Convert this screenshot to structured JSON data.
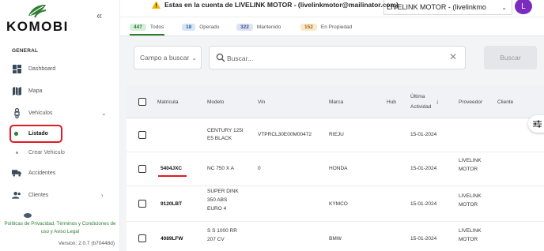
{
  "brand": {
    "logo_text": "KOMOBI",
    "accent": "#2e7d32"
  },
  "sidebar": {
    "section_label": "GENERAL",
    "items": [
      {
        "label": "Dashboard",
        "icon": "dashboard-icon"
      },
      {
        "label": "Mapa",
        "icon": "map-icon"
      },
      {
        "label": "Vehículos",
        "icon": "vehicle-icon",
        "expanded": true
      },
      {
        "label": "Accidentes",
        "icon": "accident-truck-icon"
      },
      {
        "label": "Clientes",
        "icon": "clients-icon"
      }
    ],
    "sub_items": [
      {
        "label": "Listado",
        "active": true
      },
      {
        "label": "Crear Vehiculo",
        "active": false
      }
    ],
    "footer_links": "Políticas de Privacidad, Términos y Condiciones de uso y Aviso Legal",
    "version": "Version: 2.0.7 (b70448d)"
  },
  "topbar": {
    "warning": "Estas en la cuenta de LIVELINK MOTOR - (livelinkmotor@mailinator.com)",
    "account": "LIVELINK MOTOR - (livelinkmo",
    "avatar_initial": "L"
  },
  "tabs": [
    {
      "count": "447",
      "label": "Todos",
      "bg": "#d7efd8",
      "fg": "#2e7d32",
      "active": true
    },
    {
      "count": "18",
      "label": "Operado",
      "bg": "#d6e6f7",
      "fg": "#2f5f95"
    },
    {
      "count": "322",
      "label": "Mantenido",
      "bg": "#dde3f3",
      "fg": "#3b4d8a"
    },
    {
      "count": "152",
      "label": "En Propiedad",
      "bg": "#fbe9c9",
      "fg": "#9a6b12"
    }
  ],
  "filters": {
    "field_placeholder": "Campo a buscar",
    "search_placeholder": "Buscar...",
    "search_button": "Buscar"
  },
  "table": {
    "headers": {
      "matricula": "Matricula",
      "modelo": "Modelo",
      "vin": "Vin",
      "marca": "Marca",
      "hub": "Hub",
      "ultima_line1": "Última",
      "ultima_line2": "Actividad",
      "proveedor": "Proveedor",
      "cliente": "Cliente"
    },
    "rows": [
      {
        "matricula": "",
        "modelo_l1": "CENTURY 125I",
        "modelo_l2": "E5 BLACK",
        "modelo_l3": "",
        "vin": "VTPRCL30E00M00472",
        "marca": "RIEJU",
        "actividad": "15-01-2024",
        "prov_l1": "",
        "prov_l2": ""
      },
      {
        "matricula": "5404JXC",
        "modelo_l1": "NC 750 X A",
        "modelo_l2": "",
        "modelo_l3": "",
        "vin": "0",
        "marca": "HONDA",
        "actividad": "15-01-2024",
        "prov_l1": "LIVELINK",
        "prov_l2": "MOTOR"
      },
      {
        "matricula": "9120LBT",
        "modelo_l1": "SUPER DINK",
        "modelo_l2": "350 ABS",
        "modelo_l3": "EURO 4",
        "vin": "",
        "marca": "KYMCO",
        "actividad": "15-01-2024",
        "prov_l1": "LIVELINK",
        "prov_l2": "MOTOR"
      },
      {
        "matricula": "4089LFW",
        "modelo_l1": "S S 1000 RR",
        "modelo_l2": "207 CV",
        "modelo_l3": "",
        "vin": "",
        "marca": "BMW",
        "actividad": "15-01-2024",
        "prov_l1": "LIVELINK",
        "prov_l2": "MOTOR"
      }
    ]
  }
}
